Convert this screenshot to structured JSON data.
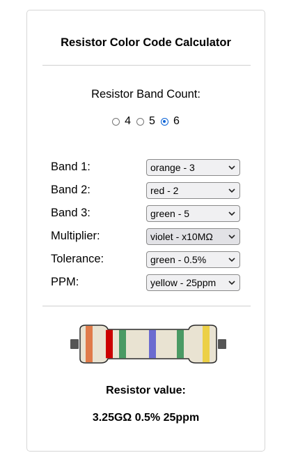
{
  "title": "Resistor Color Code Calculator",
  "band_count": {
    "label": "Resistor Band Count:",
    "options": [
      "4",
      "5",
      "6"
    ],
    "selected": "6"
  },
  "bands": [
    {
      "label": "Band 1:",
      "value": "orange - 3",
      "color": "#e07b4a"
    },
    {
      "label": "Band 2:",
      "value": "red - 2",
      "color": "#cc0000"
    },
    {
      "label": "Band 3:",
      "value": "green - 5",
      "color": "#4a9a64"
    },
    {
      "label": "Multiplier:",
      "value": "violet - x10MΩ",
      "color": "#6b6bd0"
    },
    {
      "label": "Tolerance:",
      "value": "green - 0.5%",
      "color": "#4a9a64"
    },
    {
      "label": "PPM:",
      "value": "yellow - 25ppm",
      "color": "#ecd046"
    }
  ],
  "result": {
    "label": "Resistor value:",
    "value": "3.25GΩ 0.5% 25ppm"
  },
  "colors": {
    "body": "#e9e3d2",
    "lead": "#555555",
    "radio_accent": "#0b63d6"
  }
}
